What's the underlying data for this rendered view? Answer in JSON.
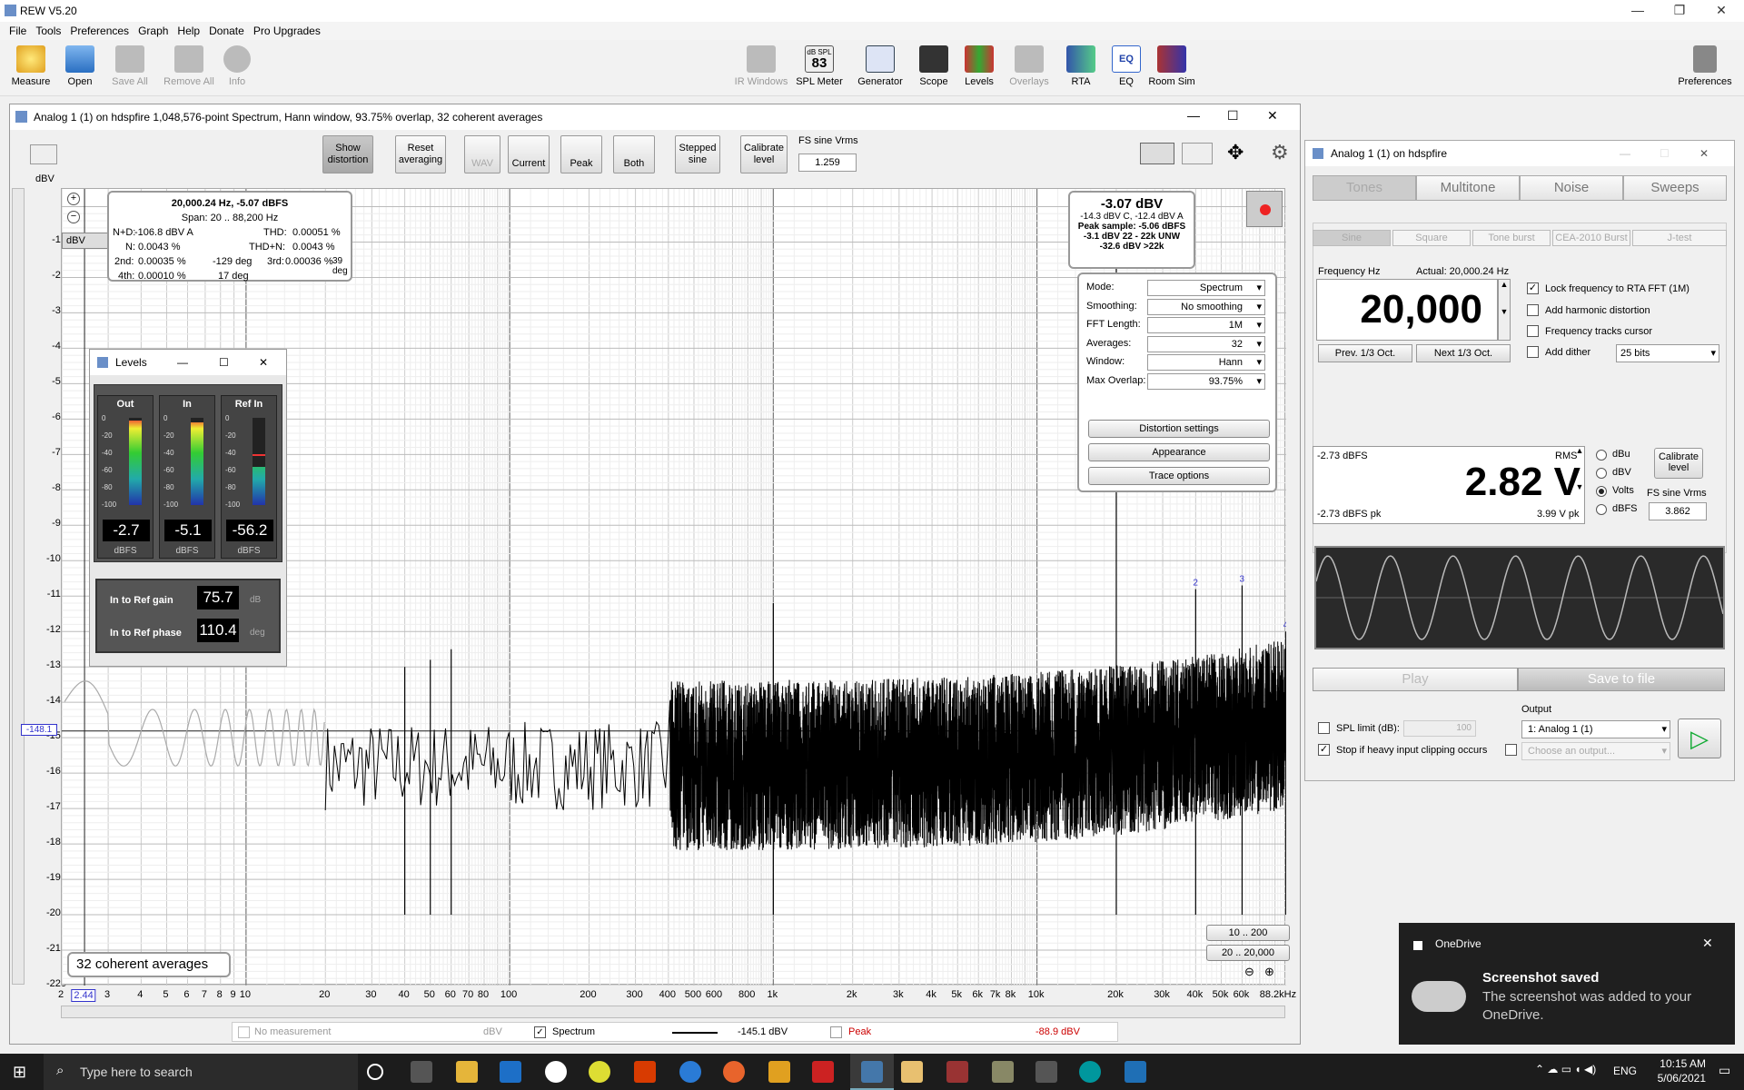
{
  "app": {
    "title": "REW V5.20"
  },
  "menu": [
    "File",
    "Tools",
    "Preferences",
    "Graph",
    "Help",
    "Donate",
    "Pro Upgrades"
  ],
  "toolbar": {
    "left": [
      {
        "label": "Measure"
      },
      {
        "label": "Open"
      },
      {
        "label": "Save All"
      },
      {
        "label": "Remove All"
      },
      {
        "label": "Info"
      }
    ],
    "center": [
      {
        "label": "IR Windows"
      },
      {
        "label": "SPL Meter"
      },
      {
        "label": "Generator"
      },
      {
        "label": "Scope"
      },
      {
        "label": "Levels"
      },
      {
        "label": "Overlays"
      },
      {
        "label": "RTA"
      },
      {
        "label": "EQ"
      },
      {
        "label": "Room Sim"
      }
    ],
    "spl_badge_top": "dB SPL",
    "spl_badge_value": "83",
    "preferences": "Preferences"
  },
  "spectrum": {
    "title": "Analog 1 (1) on hdspfire 1,048,576-point Spectrum, Hann window, 93.75% overlap, 32 coherent averages",
    "buttons": {
      "show_distortion": "Show distortion",
      "reset_averaging": "Reset averaging",
      "wav": "WAV",
      "current": "Current",
      "peak": "Peak",
      "both": "Both",
      "stepped_sine": "Stepped sine",
      "calibrate_level": "Calibrate level"
    },
    "fs_label": "FS sine Vrms",
    "fs_value": "1.259",
    "y_unit": "dBV",
    "unit_select": "dBV",
    "y_ticks": [
      "0",
      "-10",
      "-20",
      "-30",
      "-40",
      "-50",
      "-60",
      "-70",
      "-80",
      "-90",
      "-100",
      "-110",
      "-120",
      "-130",
      "-140",
      "-150",
      "-160",
      "-170",
      "-180",
      "-190",
      "-200",
      "-210",
      "-220"
    ],
    "x_ticks": [
      "2",
      "3",
      "4",
      "5",
      "6",
      "7",
      "8",
      "9",
      "10",
      "20",
      "30",
      "40",
      "50",
      "60",
      "70",
      "80",
      "100",
      "200",
      "300",
      "400",
      "500",
      "600",
      "800",
      "1k",
      "2k",
      "3k",
      "4k",
      "5k",
      "6k",
      "7k",
      "8k",
      "10k",
      "20k",
      "30k",
      "40k",
      "50k",
      "60k",
      "88.2kHz"
    ],
    "cursor_x": "2.44",
    "cursor_y": "-148.1",
    "dist": {
      "line1": "20,000.24 Hz, -5.07 dBFS",
      "span": "Span: 20 .. 88,200 Hz",
      "nd_l": "N+D:",
      "nd": "-106.8 dBV A",
      "thd_l": "THD:",
      "thd": "0.00051 %",
      "n_l": "N:",
      "n": "0.0043 %",
      "thdn_l": "THD+N:",
      "thdn": "0.0043 %",
      "h2_l": "2nd:",
      "h2": "0.00035 %",
      "h2p": "-129 deg",
      "h3_l": "3rd:",
      "h3": "0.00036 %",
      "h3p": "39 deg",
      "h4_l": "4th:",
      "h4": "0.00010 %",
      "h4p": "17 deg"
    },
    "level": {
      "main": "-3.07 dBV",
      "l2": "-14.3 dBV C, -12.4 dBV A",
      "l3": "Peak sample: -5.06 dBFS",
      "l4": "-3.1 dBV 22 - 22k UNW",
      "l5": "-32.6 dBV >22k"
    },
    "controls": [
      {
        "label": "Mode:",
        "value": "Spectrum"
      },
      {
        "label": "Smoothing:",
        "value": "No  smoothing"
      },
      {
        "label": "FFT Length:",
        "value": "1M"
      },
      {
        "label": "Averages:",
        "value": "32"
      },
      {
        "label": "Window:",
        "value": "Hann"
      },
      {
        "label": "Max Overlap:",
        "value": "93.75%"
      }
    ],
    "ctrl_buttons": [
      "Distortion settings",
      "Appearance",
      "Trace options"
    ],
    "range1": "10 .. 200",
    "range2": "20 .. 20,000",
    "averages_note": "32 coherent averages",
    "harmonic_markers": [
      "2",
      "3",
      "4"
    ],
    "legend": {
      "nomeas": "No measurement",
      "nomeas_unit": "dBV",
      "spectrum": "Spectrum",
      "spectrum_val": "-145.1 dBV",
      "peak": "Peak",
      "peak_val": "-88.9 dBV"
    }
  },
  "levels": {
    "title": "Levels",
    "meters": [
      {
        "name": "Out",
        "value": "-2.7",
        "unit": "dBFS",
        "level": 0.97
      },
      {
        "name": "In",
        "value": "-5.1",
        "unit": "dBFS",
        "level": 0.95
      },
      {
        "name": "Ref In",
        "value": "-56.2",
        "unit": "dBFS",
        "level": 0.44
      }
    ],
    "scale": [
      "0",
      "-20",
      "-40",
      "-60",
      "-80",
      "-100"
    ],
    "gain_label": "In to Ref gain",
    "gain_value": "75.7",
    "gain_unit": "dB",
    "phase_label": "In to Ref phase",
    "phase_value": "110.4",
    "phase_unit": "deg"
  },
  "generator": {
    "title": "Analog 1 (1) on hdspfire",
    "tabs": [
      "Tones",
      "Multitone",
      "Noise",
      "Sweeps"
    ],
    "subtabs": [
      "Sine",
      "Square",
      "Tone burst",
      "CEA-2010 Burst",
      "J-test"
    ],
    "freq_label": "Frequency Hz",
    "actual": "Actual: 20,000.24 Hz",
    "freq": "20,000",
    "prev": "Prev. 1/3 Oct.",
    "next": "Next 1/3 Oct.",
    "lock": "Lock frequency to RTA FFT (1M)",
    "harm": "Add harmonic distortion",
    "track": "Frequency tracks cursor",
    "dither": "Add dither",
    "dither_bits": "25 bits",
    "lvl_dbfs": "-2.73 dBFS",
    "rms": "RMS",
    "volts": "2.82 V",
    "pk_dbfs": "-2.73 dBFS pk",
    "vpk": "3.99 V pk",
    "units": [
      "dBu",
      "dBV",
      "Volts",
      "dBFS"
    ],
    "calibrate": "Calibrate level",
    "fs_label": "FS sine Vrms",
    "fs_value": "3.862",
    "play": "Play",
    "save": "Save to file",
    "spl_limit": "SPL limit (dB):",
    "spl_val": "100",
    "stop_clip": "Stop if heavy input clipping occurs",
    "output_label": "Output",
    "output": "1: Analog 1 (1)",
    "output2": "Choose an output..."
  },
  "toast": {
    "app": "OneDrive",
    "title": "Screenshot saved",
    "body": "The screenshot was added to your OneDrive."
  },
  "taskbar": {
    "search": "Type here to search",
    "lang": "ENG",
    "time": "10:15 AM",
    "date": "5/06/2021"
  }
}
